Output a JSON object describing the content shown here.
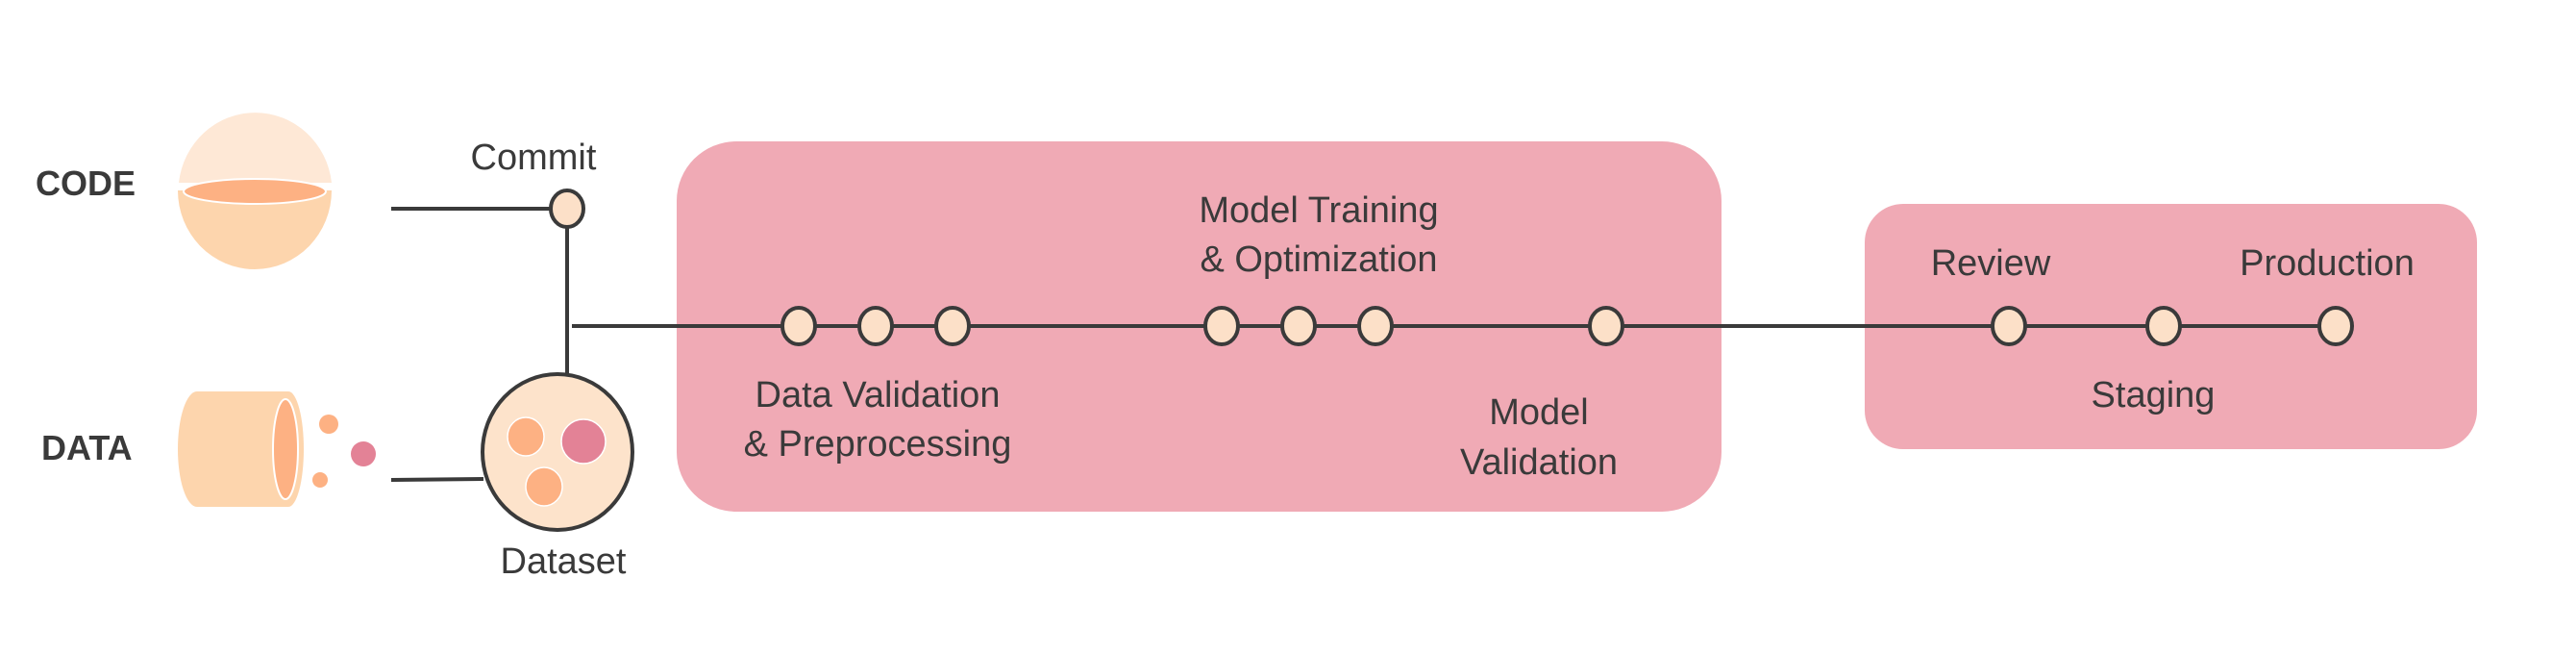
{
  "inputs": {
    "code_label": "CODE",
    "data_label": "DATA"
  },
  "commit": {
    "label": "Commit"
  },
  "dataset": {
    "label": "Dataset"
  },
  "stage_box_1": {
    "data_validation": [
      "Data Validation",
      "& Preprocessing"
    ],
    "model_training": [
      "Model Training",
      "& Optimization"
    ],
    "model_validation": [
      "Model",
      "Validation"
    ]
  },
  "stage_box_2": {
    "review": "Review",
    "staging": "Staging",
    "production": "Production"
  },
  "colors": {
    "stage_box": "#f0aab5",
    "node_fill": "#fce0c8",
    "line": "#3a3a3a",
    "orange": "#fdb183",
    "peach": "#fdd5ad",
    "pink": "#e38296"
  }
}
